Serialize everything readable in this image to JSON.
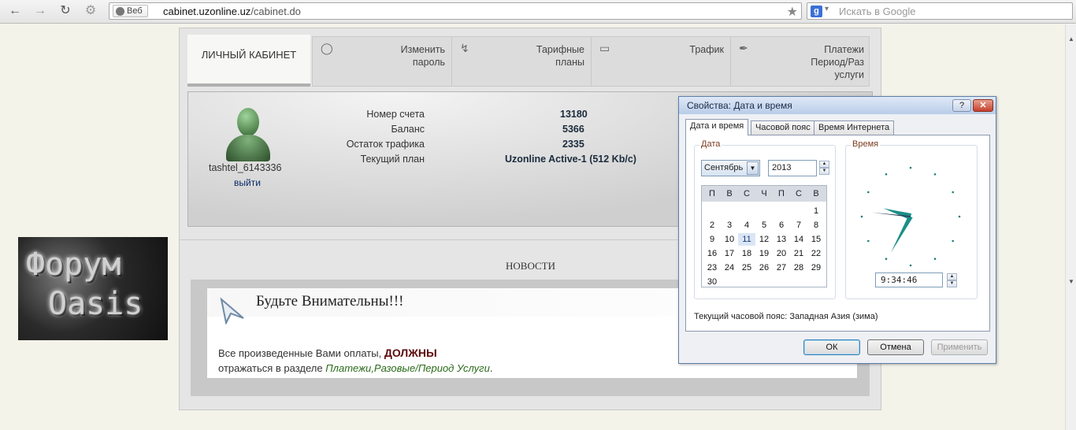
{
  "browser": {
    "omnibox_chip": "Веб",
    "url_domain": "cabinet.uzonline.uz",
    "url_path": "/cabinet.do",
    "search_placeholder": "Искать в Google",
    "search_engine_letter": "g"
  },
  "tabs": {
    "cabinet": "ЛИЧНЫЙ КАБИНЕТ",
    "items": [
      {
        "label": "Изменить пароль",
        "icon": "lock-icon"
      },
      {
        "label": "Тарифные планы",
        "icon": "wrench-icon"
      },
      {
        "label": "Трафик",
        "icon": "laptop-icon"
      },
      {
        "label": "Платежи Период/Раз услуги",
        "icon": "pen-icon"
      }
    ]
  },
  "profile": {
    "username": "tashtel_6143336",
    "logout": "выйти",
    "rows": [
      {
        "label": "Номер счета",
        "value": "13180"
      },
      {
        "label": "Баланс",
        "value": "5366"
      },
      {
        "label": "Остаток трафика",
        "value": "2335"
      },
      {
        "label": "Текущий план",
        "value": "Uzonline Active-1 (512 Kb/c)"
      }
    ]
  },
  "news": {
    "title": "НОВОСТИ",
    "headline": "Будьте Внимательны!!!",
    "text1_start": "Все произведенные Вами оплаты,",
    "text1_bold": "ДОЛЖНЫ",
    "text2_start": "отражаться в разделе",
    "text2_link": "Платежи,Разовые/Период Услуги",
    "text2_end": "."
  },
  "forum_banner": {
    "line1": "Форум",
    "line2": "Oasis"
  },
  "dialog": {
    "title": "Свойства: Дата и время",
    "help": "?",
    "tabs": [
      "Дата и время",
      "Часовой пояс",
      "Время Интернета"
    ],
    "date_group": "Дата",
    "time_group": "Время",
    "month": "Сентябрь",
    "year": "2013",
    "weekdays": [
      "П",
      "В",
      "С",
      "Ч",
      "П",
      "С",
      "В"
    ],
    "selected_day": "11",
    "time": "9:34:46",
    "timezone": "Текущий часовой пояс: Западная Азия (зима)",
    "buttons": {
      "ok": "ОК",
      "cancel": "Отмена",
      "apply": "Применить"
    }
  }
}
